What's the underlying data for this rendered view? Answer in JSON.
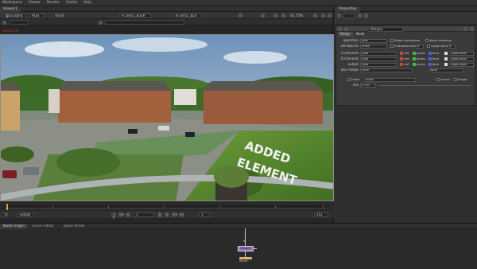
{
  "menubar": [
    "Workspace",
    "Viewer",
    "Render",
    "Cache",
    "Help"
  ],
  "viewer": {
    "tab_label": "Viewer1",
    "channels_dd": "rgba.alpha",
    "colorspace_dd": "RGB",
    "proxy_dd": "sRGB",
    "input_a": "A  Lens2_bunR",
    "input_b": "B  Lens2_bun",
    "zoom_value": "43.75%",
    "frame_field": "1",
    "red_overlay_label": "Lens2 1/1",
    "info_left": "ID_4K 3840x2160  bbox: 0 0 3840 2160  channels: rgba",
    "info_mid": "x=0 y=0",
    "image_overlay_text": [
      "ADDED",
      "ELEMENT"
    ]
  },
  "timeline": {
    "global_label": "Global",
    "frame_label": "1",
    "frame_start": "1",
    "frame_end": "251",
    "fps_label": "10",
    "transport": [
      "|<",
      "<<",
      "<",
      "||",
      ">",
      ">>",
      ">|"
    ]
  },
  "nodegraph": {
    "tabs": [
      "Node Graph",
      "Curve Editor",
      "Dope Sheet"
    ],
    "node_label": "Merge2",
    "node_top_label": "B",
    "node_bottom_label": "Read1"
  },
  "properties": {
    "title": "Properties",
    "node_name": "Merge2",
    "tabs": [
      "Merge",
      "Node"
    ],
    "rows": [
      {
        "label": "operation",
        "value": "over",
        "extra": "Video colorspace",
        "extra2": "alpha masking"
      },
      {
        "label": "set bbox to",
        "value": "union",
        "extra": "metadata from",
        "extra_val": "B",
        "extra2": "range from",
        "extra2_val": "B"
      },
      {
        "label": "A channels",
        "value": "rgba"
      },
      {
        "label": "B channels",
        "value": "rgba"
      },
      {
        "label": "output",
        "value": "rgba"
      },
      {
        "label": "also merge",
        "value": "none",
        "extra_val": "none"
      }
    ],
    "channel_labels": [
      "red",
      "green",
      "blue"
    ],
    "alpha_field": "rgba.alpha",
    "mask_label": "mask",
    "mask_value": "none",
    "invert_label": "invert",
    "fringe_label": "fringe",
    "mix_label": "mix",
    "mix_value": "0.355"
  }
}
